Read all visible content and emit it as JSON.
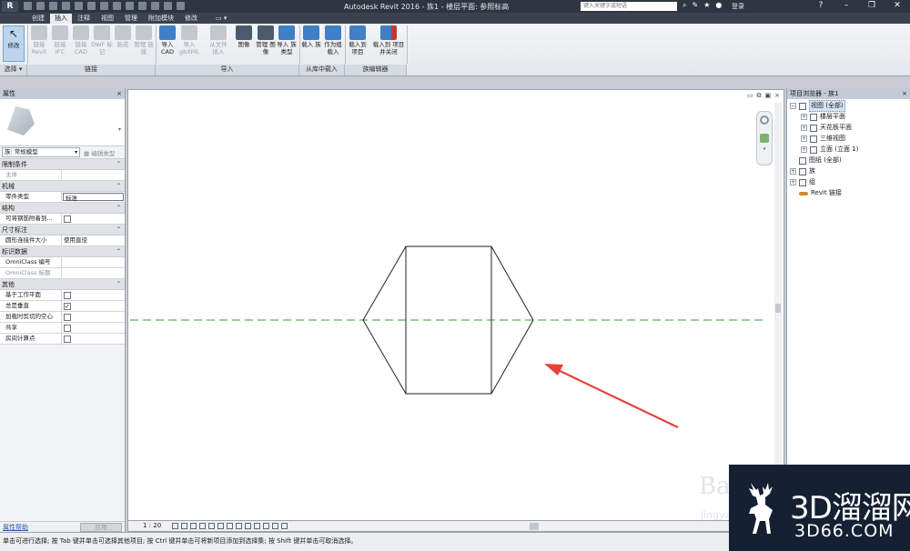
{
  "titlebar": {
    "logo": "R",
    "title": "Autodesk Revit 2016 -     族1 - 楼层平面: 参照标高",
    "search_placeholder": "键入关键字或短语",
    "login": "登录",
    "help": "?"
  },
  "tabs": [
    "创建",
    "插入",
    "注释",
    "视图",
    "管理",
    "附加模块",
    "修改"
  ],
  "active_tab": "插入",
  "ribbon": {
    "modify": "修改",
    "modify_select": "选择 ▾",
    "link_buttons": [
      "链接 Revit",
      "链接 IFC",
      "链接 CAD",
      "DWF 标记",
      "贴花",
      "管理 链接"
    ],
    "link_group": "链接",
    "import_buttons": [
      "导入 CAD",
      "导入 gbXML",
      "从文件 插入",
      "图像",
      "管理 图像",
      "导入 族类型"
    ],
    "import_group": "导入",
    "library_buttons": [
      "载入 族",
      "作为组 载入"
    ],
    "library_group": "从库中载入",
    "family_editor_buttons": [
      "载入到 项目",
      "载入到 项目并关闭"
    ],
    "family_editor_group": "族编辑器"
  },
  "properties": {
    "title": "属性",
    "close": "×",
    "type_selector": "族: 常规模型",
    "edit_type": "编辑类型",
    "categories": [
      {
        "name": "限制条件",
        "rows": [
          {
            "name": "主体",
            "value": "",
            "grey": true
          }
        ]
      },
      {
        "name": "机械",
        "rows": [
          {
            "name": "零件类型",
            "value": "标准",
            "input": true
          }
        ]
      },
      {
        "name": "结构",
        "rows": [
          {
            "name": "可将钢筋附着到...",
            "check": false
          }
        ]
      },
      {
        "name": "尺寸标注",
        "rows": [
          {
            "name": "圆形连接件大小",
            "value": "使用直径"
          }
        ]
      },
      {
        "name": "标识数据",
        "rows": [
          {
            "name": "OmniClass 编号",
            "value": ""
          },
          {
            "name": "OmniClass 标题",
            "value": "",
            "grey": true
          }
        ]
      },
      {
        "name": "其他",
        "rows": [
          {
            "name": "基于工作平面",
            "check": false
          },
          {
            "name": "总是垂直",
            "check": true
          },
          {
            "name": "加载时剪切的空心",
            "check": false
          },
          {
            "name": "共享",
            "check": false
          },
          {
            "name": "房间计算点",
            "check": false
          }
        ]
      }
    ],
    "help_link": "属性帮助",
    "apply": "应用"
  },
  "canvas": {
    "window_controls": [
      "▭",
      "⧉",
      "▣",
      "×"
    ],
    "scale": "1 : 20"
  },
  "browser": {
    "title": "项目浏览器 - 族1",
    "close": "×",
    "items": [
      {
        "label": "视图 (全部)",
        "level": 0,
        "pm": "−",
        "selected": true
      },
      {
        "label": "楼层平面",
        "level": 1,
        "pm": "+"
      },
      {
        "label": "天花板平面",
        "level": 1,
        "pm": "+"
      },
      {
        "label": "三维视图",
        "level": 1,
        "pm": "+"
      },
      {
        "label": "立面 (立面 1)",
        "level": 1,
        "pm": "+"
      },
      {
        "label": "图纸 (全部)",
        "level": 0,
        "pm": ""
      },
      {
        "label": "族",
        "level": 0,
        "pm": "+"
      },
      {
        "label": "组",
        "level": 0,
        "pm": "+"
      },
      {
        "label": "Revit 链接",
        "level": 0,
        "pm": "",
        "link": true
      }
    ]
  },
  "status": {
    "text": "单击可进行选择; 按 Tab 键并单击可选择其他项目; 按 Ctrl 键并单击可将新项目添加到选择集; 按 Shift 键并单击可取消选择。"
  },
  "watermark": {
    "cn": "3D溜溜网",
    "en": "3D66.COM",
    "bg": "Ba",
    "bg2": "jingyan"
  },
  "colors": {
    "arrow": "#e8423a",
    "reference_line": "#3a9a3a",
    "shape_stroke": "#222222"
  }
}
